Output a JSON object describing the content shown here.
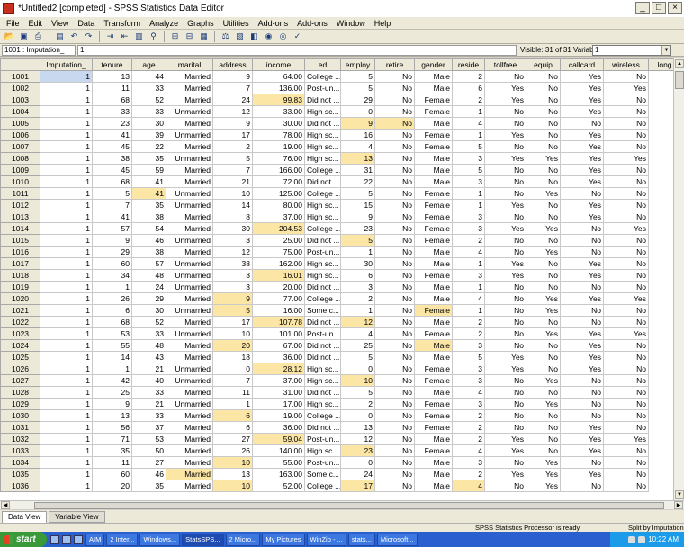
{
  "window": {
    "title": "*Untitled2 [completed] - SPSS Statistics Data Editor",
    "min": "_",
    "max": "□",
    "close": "×"
  },
  "menu": [
    "File",
    "Edit",
    "View",
    "Data",
    "Transform",
    "Analyze",
    "Graphs",
    "Utilities",
    "Add-ons",
    "Add-ons",
    "Window",
    "Help"
  ],
  "toolbar": [
    "open-icon",
    "save-icon",
    "print-icon",
    "dialog-recall-icon",
    "undo-icon",
    "redo-icon",
    "goto-case-icon",
    "goto-variable-icon",
    "variables-icon",
    "find-icon",
    "insert-cases-icon",
    "insert-variable-icon",
    "split-file-icon",
    "weight-cases-icon",
    "select-cases-icon",
    "value-labels-icon",
    "use-sets-icon",
    "show-all-icon",
    "spelling-icon"
  ],
  "cellbar": {
    "ref": "1001 : Imputation_",
    "value": "1",
    "visible": "Visible: 31 of 31 Variables",
    "selector": "1"
  },
  "columns": [
    "Imputation_",
    "tenure",
    "age",
    "marital",
    "address",
    "income",
    "ed",
    "employ",
    "retire",
    "gender",
    "reside",
    "tollfree",
    "equip",
    "callcard",
    "wireless",
    "long"
  ],
  "rows": [
    [
      "1001",
      "1",
      "13",
      "44",
      "Married",
      "9",
      "64.00",
      "College ...",
      "5",
      "No",
      "Male",
      "2",
      "No",
      "No",
      "Yes",
      "No"
    ],
    [
      "1002",
      "1",
      "11",
      "33",
      "Married",
      "7",
      "136.00",
      "Post-un...",
      "5",
      "No",
      "Male",
      "6",
      "Yes",
      "No",
      "Yes",
      "Yes"
    ],
    [
      "1003",
      "1",
      "68",
      "52",
      "Married",
      "24",
      "99.83",
      "Did not ...",
      "29",
      "No",
      "Female",
      "2",
      "Yes",
      "No",
      "Yes",
      "No"
    ],
    [
      "1004",
      "1",
      "33",
      "33",
      "Unmarried",
      "12",
      "33.00",
      "High sc...",
      "0",
      "No",
      "Female",
      "1",
      "No",
      "No",
      "Yes",
      "No"
    ],
    [
      "1005",
      "1",
      "23",
      "30",
      "Married",
      "9",
      "30.00",
      "Did not ...",
      "9",
      "No",
      "Male",
      "4",
      "No",
      "No",
      "No",
      "No"
    ],
    [
      "1006",
      "1",
      "41",
      "39",
      "Unmarried",
      "17",
      "78.00",
      "High sc...",
      "16",
      "No",
      "Female",
      "1",
      "Yes",
      "No",
      "Yes",
      "No"
    ],
    [
      "1007",
      "1",
      "45",
      "22",
      "Married",
      "2",
      "19.00",
      "High sc...",
      "4",
      "No",
      "Female",
      "5",
      "No",
      "No",
      "Yes",
      "No"
    ],
    [
      "1008",
      "1",
      "38",
      "35",
      "Unmarried",
      "5",
      "76.00",
      "High sc...",
      "13",
      "No",
      "Male",
      "3",
      "Yes",
      "Yes",
      "Yes",
      "Yes"
    ],
    [
      "1009",
      "1",
      "45",
      "59",
      "Married",
      "7",
      "166.00",
      "College ...",
      "31",
      "No",
      "Male",
      "5",
      "No",
      "No",
      "Yes",
      "No"
    ],
    [
      "1010",
      "1",
      "68",
      "41",
      "Married",
      "21",
      "72.00",
      "Did not ...",
      "22",
      "No",
      "Male",
      "3",
      "No",
      "No",
      "Yes",
      "No"
    ],
    [
      "1011",
      "1",
      "5",
      "41",
      "Unmarried",
      "10",
      "125.00",
      "College ...",
      "5",
      "No",
      "Female",
      "1",
      "No",
      "Yes",
      "No",
      "No"
    ],
    [
      "1012",
      "1",
      "7",
      "35",
      "Unmarried",
      "14",
      "80.00",
      "High sc...",
      "15",
      "No",
      "Female",
      "1",
      "Yes",
      "No",
      "Yes",
      "No"
    ],
    [
      "1013",
      "1",
      "41",
      "38",
      "Married",
      "8",
      "37.00",
      "High sc...",
      "9",
      "No",
      "Female",
      "3",
      "No",
      "No",
      "Yes",
      "No"
    ],
    [
      "1014",
      "1",
      "57",
      "54",
      "Married",
      "30",
      "204.53",
      "College ...",
      "23",
      "No",
      "Female",
      "3",
      "Yes",
      "Yes",
      "No",
      "Yes"
    ],
    [
      "1015",
      "1",
      "9",
      "46",
      "Unmarried",
      "3",
      "25.00",
      "Did not ...",
      "5",
      "No",
      "Female",
      "2",
      "No",
      "No",
      "No",
      "No"
    ],
    [
      "1016",
      "1",
      "29",
      "38",
      "Married",
      "12",
      "75.00",
      "Post-un...",
      "1",
      "No",
      "Male",
      "4",
      "No",
      "Yes",
      "No",
      "No"
    ],
    [
      "1017",
      "1",
      "60",
      "57",
      "Unmarried",
      "38",
      "162.00",
      "High sc...",
      "30",
      "No",
      "Male",
      "1",
      "Yes",
      "No",
      "Yes",
      "No"
    ],
    [
      "1018",
      "1",
      "34",
      "48",
      "Unmarried",
      "3",
      "16.01",
      "High sc...",
      "6",
      "No",
      "Female",
      "3",
      "Yes",
      "No",
      "Yes",
      "No"
    ],
    [
      "1019",
      "1",
      "1",
      "24",
      "Unmarried",
      "3",
      "20.00",
      "Did not ...",
      "3",
      "No",
      "Male",
      "1",
      "No",
      "No",
      "No",
      "No"
    ],
    [
      "1020",
      "1",
      "26",
      "29",
      "Married",
      "9",
      "77.00",
      "College ...",
      "2",
      "No",
      "Male",
      "4",
      "No",
      "Yes",
      "Yes",
      "Yes"
    ],
    [
      "1021",
      "1",
      "6",
      "30",
      "Unmarried",
      "5",
      "16.00",
      "Some c...",
      "1",
      "No",
      "Female",
      "1",
      "No",
      "Yes",
      "No",
      "No"
    ],
    [
      "1022",
      "1",
      "68",
      "52",
      "Married",
      "17",
      "107.78",
      "Did not ...",
      "12",
      "No",
      "Male",
      "2",
      "No",
      "No",
      "No",
      "No"
    ],
    [
      "1023",
      "1",
      "53",
      "33",
      "Unmarried",
      "10",
      "101.00",
      "Post-un...",
      "4",
      "No",
      "Female",
      "2",
      "No",
      "Yes",
      "Yes",
      "Yes"
    ],
    [
      "1024",
      "1",
      "55",
      "48",
      "Married",
      "20",
      "67.00",
      "Did not ...",
      "25",
      "No",
      "Male",
      "3",
      "No",
      "No",
      "Yes",
      "No"
    ],
    [
      "1025",
      "1",
      "14",
      "43",
      "Married",
      "18",
      "36.00",
      "Did not ...",
      "5",
      "No",
      "Male",
      "5",
      "Yes",
      "No",
      "Yes",
      "No"
    ],
    [
      "1026",
      "1",
      "1",
      "21",
      "Unmarried",
      "0",
      "28.12",
      "High sc...",
      "0",
      "No",
      "Female",
      "3",
      "Yes",
      "No",
      "Yes",
      "No"
    ],
    [
      "1027",
      "1",
      "42",
      "40",
      "Unmarried",
      "7",
      "37.00",
      "High sc...",
      "10",
      "No",
      "Female",
      "3",
      "No",
      "Yes",
      "No",
      "No"
    ],
    [
      "1028",
      "1",
      "25",
      "33",
      "Married",
      "11",
      "31.00",
      "Did not ...",
      "5",
      "No",
      "Male",
      "4",
      "No",
      "No",
      "No",
      "No"
    ],
    [
      "1029",
      "1",
      "9",
      "21",
      "Unmarried",
      "1",
      "17.00",
      "High sc...",
      "2",
      "No",
      "Female",
      "3",
      "No",
      "Yes",
      "No",
      "No"
    ],
    [
      "1030",
      "1",
      "13",
      "33",
      "Married",
      "6",
      "19.00",
      "College ...",
      "0",
      "No",
      "Female",
      "2",
      "No",
      "No",
      "No",
      "No"
    ],
    [
      "1031",
      "1",
      "56",
      "37",
      "Married",
      "6",
      "36.00",
      "Did not ...",
      "13",
      "No",
      "Female",
      "2",
      "No",
      "No",
      "Yes",
      "No"
    ],
    [
      "1032",
      "1",
      "71",
      "53",
      "Married",
      "27",
      "59.04",
      "Post-un...",
      "12",
      "No",
      "Male",
      "2",
      "Yes",
      "No",
      "Yes",
      "Yes"
    ],
    [
      "1033",
      "1",
      "35",
      "50",
      "Married",
      "26",
      "140.00",
      "High sc...",
      "23",
      "No",
      "Female",
      "4",
      "Yes",
      "No",
      "Yes",
      "No"
    ],
    [
      "1034",
      "1",
      "11",
      "27",
      "Married",
      "10",
      "55.00",
      "Post-un...",
      "0",
      "No",
      "Male",
      "3",
      "No",
      "Yes",
      "No",
      "No"
    ],
    [
      "1035",
      "1",
      "60",
      "46",
      "Married",
      "13",
      "163.00",
      "Some c...",
      "24",
      "No",
      "Male",
      "2",
      "Yes",
      "Yes",
      "Yes",
      "No"
    ],
    [
      "1036",
      "1",
      "20",
      "35",
      "Married",
      "10",
      "52.00",
      "College ...",
      "17",
      "No",
      "Male",
      "4",
      "No",
      "Yes",
      "No",
      "No"
    ]
  ],
  "highlights": [
    [
      1003,
      6
    ],
    [
      1005,
      8
    ],
    [
      1005,
      9
    ],
    [
      1008,
      8
    ],
    [
      1011,
      3
    ],
    [
      1014,
      6
    ],
    [
      1015,
      8
    ],
    [
      1018,
      6
    ],
    [
      1020,
      5
    ],
    [
      1021,
      5
    ],
    [
      1021,
      10
    ],
    [
      1022,
      6
    ],
    [
      1022,
      8
    ],
    [
      1024,
      5
    ],
    [
      1024,
      10
    ],
    [
      1026,
      6
    ],
    [
      1027,
      8
    ],
    [
      1030,
      5
    ],
    [
      1032,
      6
    ],
    [
      1033,
      8
    ],
    [
      1034,
      5
    ],
    [
      1035,
      4
    ],
    [
      1036,
      5
    ],
    [
      1036,
      8
    ],
    [
      1036,
      11
    ]
  ],
  "tabs": [
    "Data View",
    "Variable View"
  ],
  "status": {
    "processor": "SPSS Statistics  Processor is ready",
    "split": "Split by Imputation"
  },
  "taskbar": {
    "start": "start",
    "tasks": [
      "AIM",
      "2 Inter...",
      "Windows...",
      "StatsSPS...",
      "2 Micro...",
      "My Pictures",
      "WinZip - ...",
      "stats...",
      "Microsoft..."
    ],
    "clock": "10:22 AM"
  }
}
